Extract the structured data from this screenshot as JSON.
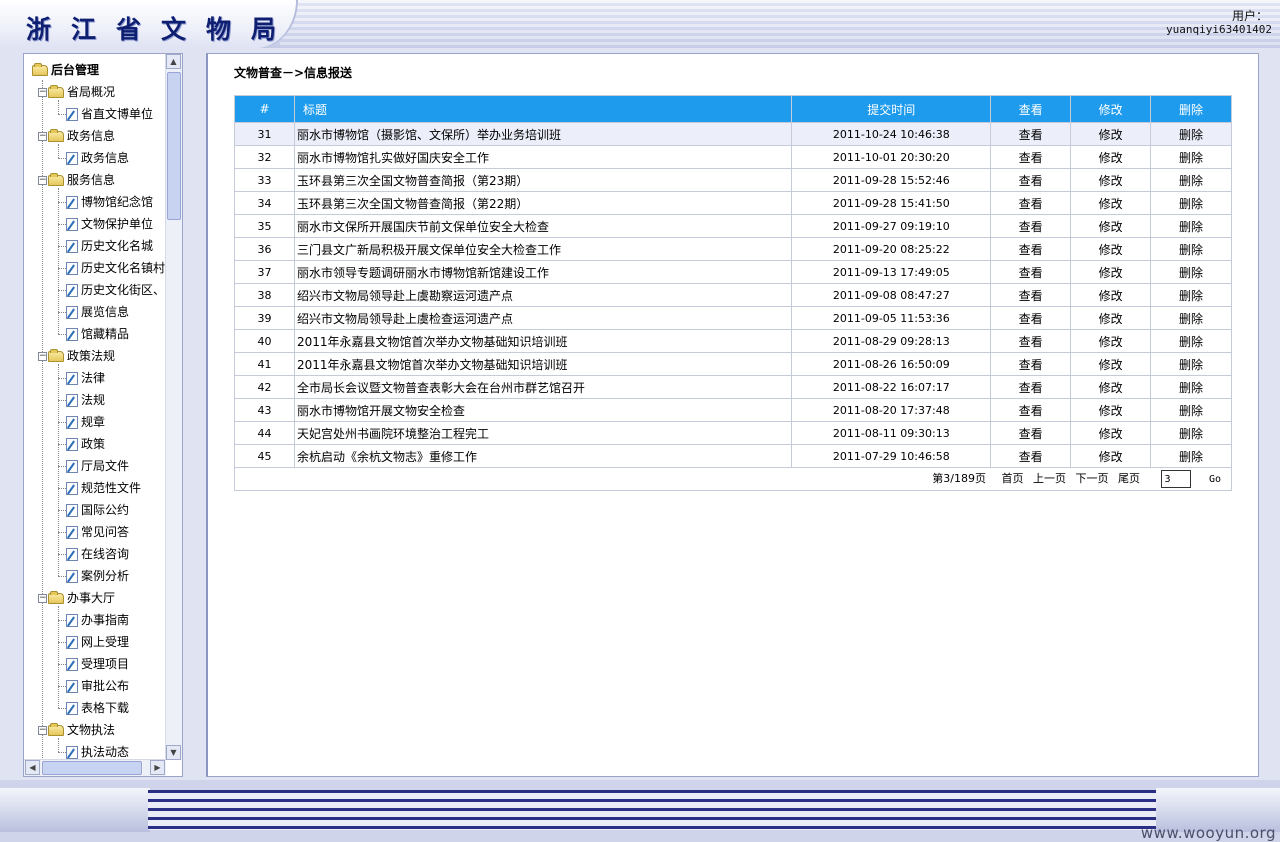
{
  "header": {
    "logo": "浙江省文物局",
    "user_label": "用户：",
    "user_name": "yuanqiyi63401402"
  },
  "sidebar": {
    "root": "后台管理",
    "groups": [
      {
        "label": "省局概况",
        "items": [
          "省直文博单位"
        ]
      },
      {
        "label": "政务信息",
        "items": [
          "政务信息"
        ]
      },
      {
        "label": "服务信息",
        "items": [
          "博物馆纪念馆",
          "文物保护单位",
          "历史文化名城",
          "历史文化名镇村",
          "历史文化街区、",
          "展览信息",
          "馆藏精品"
        ]
      },
      {
        "label": "政策法规",
        "items": [
          "法律",
          "法规",
          "规章",
          "政策",
          "厅局文件",
          "规范性文件",
          "国际公约",
          "常见问答",
          "在线咨询",
          "案例分析"
        ]
      },
      {
        "label": "办事大厅",
        "items": [
          "办事指南",
          "网上受理",
          "受理项目",
          "审批公布",
          "表格下载"
        ]
      },
      {
        "label": "文物执法",
        "items": [
          "执法动态"
        ]
      }
    ]
  },
  "main": {
    "breadcrumb": "文物普查－>信息报送",
    "columns": [
      "#",
      "标题",
      "提交时间",
      "查看",
      "修改",
      "删除"
    ],
    "action_labels": {
      "view": "查看",
      "edit": "修改",
      "delete": "删除"
    },
    "rows": [
      {
        "id": "31",
        "title": "丽水市博物馆（摄影馆、文保所）举办业务培训班",
        "time": "2011-10-24 10:46:38"
      },
      {
        "id": "32",
        "title": "丽水市博物馆扎实做好国庆安全工作",
        "time": "2011-10-01 20:30:20"
      },
      {
        "id": "33",
        "title": "玉环县第三次全国文物普查简报（第23期）",
        "time": "2011-09-28 15:52:46"
      },
      {
        "id": "34",
        "title": "玉环县第三次全国文物普查简报（第22期）",
        "time": "2011-09-28 15:41:50"
      },
      {
        "id": "35",
        "title": "丽水市文保所开展国庆节前文保单位安全大检查",
        "time": "2011-09-27 09:19:10"
      },
      {
        "id": "36",
        "title": "三门县文广新局积极开展文保单位安全大检查工作",
        "time": "2011-09-20 08:25:22"
      },
      {
        "id": "37",
        "title": "丽水市领导专题调研丽水市博物馆新馆建设工作",
        "time": "2011-09-13 17:49:05"
      },
      {
        "id": "38",
        "title": "绍兴市文物局领导赴上虞勘察运河遗产点",
        "time": "2011-09-08 08:47:27"
      },
      {
        "id": "39",
        "title": "绍兴市文物局领导赴上虞检查运河遗产点",
        "time": "2011-09-05 11:53:36"
      },
      {
        "id": "40",
        "title": "2011年永嘉县文物馆首次举办文物基础知识培训班",
        "time": "2011-08-29 09:28:13"
      },
      {
        "id": "41",
        "title": "2011年永嘉县文物馆首次举办文物基础知识培训班",
        "time": "2011-08-26 16:50:09"
      },
      {
        "id": "42",
        "title": "全市局长会议暨文物普查表彰大会在台州市群艺馆召开",
        "time": "2011-08-22 16:07:17"
      },
      {
        "id": "43",
        "title": "丽水市博物馆开展文物安全检查",
        "time": "2011-08-20 17:37:48"
      },
      {
        "id": "44",
        "title": "天妃宫处州书画院环境整治工程完工",
        "time": "2011-08-11 09:30:13"
      },
      {
        "id": "45",
        "title": "余杭启动《余杭文物志》重修工作",
        "time": "2011-07-29 10:46:58"
      }
    ],
    "pager": {
      "status": "第3/189页",
      "first": "首页",
      "prev": "上一页",
      "next": "下一页",
      "last": "尾页",
      "page_value": "3",
      "go": "Go"
    }
  },
  "footer": {
    "watermark": "www.wooyun.org"
  }
}
